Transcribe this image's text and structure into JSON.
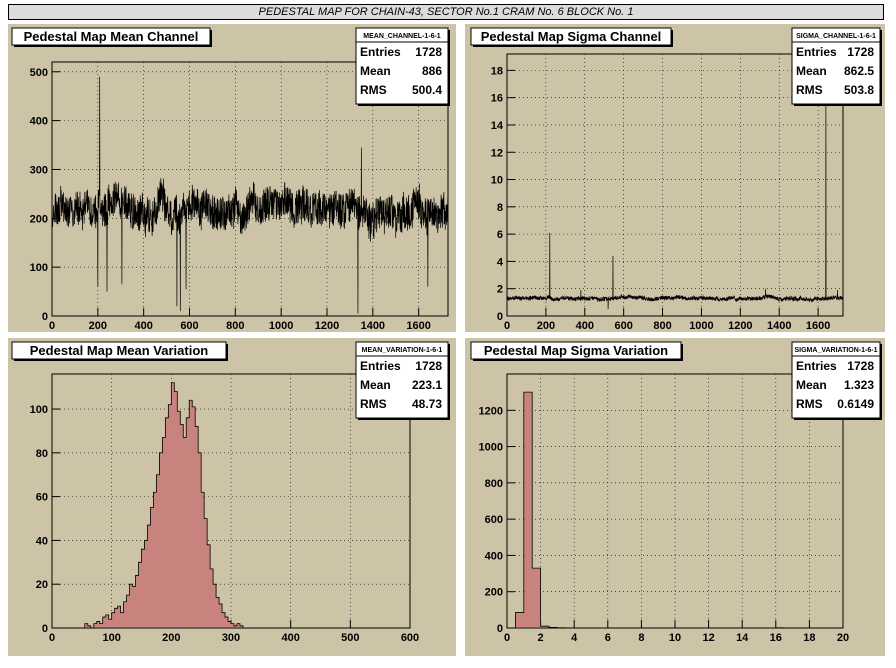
{
  "page_title": "PEDESTAL MAP FOR CHAIN-43, SECTOR No.1 CRAM No. 6 BLOCK No. 1",
  "colors": {
    "pad_bg": "#cdc4a8",
    "fill": "#c8837e",
    "line": "#000000"
  },
  "chart_data": [
    {
      "id": "mean-channel",
      "type": "line",
      "title": "Pedestal Map Mean Channel",
      "stats_name": "MEAN_CHANNEL-1-6-1",
      "stats": [
        {
          "label": "Entries",
          "value": "1728"
        },
        {
          "label": "Mean",
          "value": "886"
        },
        {
          "label": "RMS",
          "value": "500.4"
        }
      ],
      "xlim": [
        0,
        1728
      ],
      "ylim": [
        0,
        520
      ],
      "xticks": [
        0,
        200,
        400,
        600,
        800,
        1000,
        1200,
        1400,
        1600
      ],
      "yticks": [
        0,
        100,
        200,
        300,
        400,
        500
      ],
      "baseline": 220,
      "noise": 45,
      "n_points": 1728,
      "spikes": [
        {
          "x": 200,
          "y": 60
        },
        {
          "x": 208,
          "y": 490
        },
        {
          "x": 240,
          "y": 50
        },
        {
          "x": 305,
          "y": 65
        },
        {
          "x": 545,
          "y": 20
        },
        {
          "x": 560,
          "y": 10
        },
        {
          "x": 585,
          "y": 55
        },
        {
          "x": 1335,
          "y": 5
        },
        {
          "x": 1350,
          "y": 345
        },
        {
          "x": 1640,
          "y": 60
        }
      ]
    },
    {
      "id": "sigma-channel",
      "type": "line",
      "title": "Pedestal Map Sigma Channel",
      "stats_name": "SIGMA_CHANNEL-1-6-1",
      "stats": [
        {
          "label": "Entries",
          "value": "1728"
        },
        {
          "label": "Mean",
          "value": "862.5"
        },
        {
          "label": "RMS",
          "value": "503.8"
        }
      ],
      "xlim": [
        0,
        1728
      ],
      "ylim": [
        0,
        19.2
      ],
      "xticks": [
        0,
        200,
        400,
        600,
        800,
        1000,
        1200,
        1400,
        1600
      ],
      "yticks": [
        0,
        2,
        4,
        6,
        8,
        10,
        12,
        14,
        16,
        18
      ],
      "baseline": 1.3,
      "noise": 0.18,
      "n_points": 1728,
      "spikes": [
        {
          "x": 220,
          "y": 6.1
        },
        {
          "x": 380,
          "y": 1.9
        },
        {
          "x": 520,
          "y": 0.5
        },
        {
          "x": 545,
          "y": 4.4
        },
        {
          "x": 1330,
          "y": 2.0
        },
        {
          "x": 1640,
          "y": 16.0
        },
        {
          "x": 1700,
          "y": 1.9
        }
      ]
    },
    {
      "id": "mean-variation",
      "type": "bar",
      "title": "Pedestal Map Mean Variation",
      "stats_name": "MEAN_VARIATION-1-6-1",
      "stats": [
        {
          "label": "Entries",
          "value": "1728"
        },
        {
          "label": "Mean",
          "value": "223.1"
        },
        {
          "label": "RMS",
          "value": "48.73"
        }
      ],
      "xlim": [
        0,
        600
      ],
      "ylim": [
        0,
        116
      ],
      "xticks": [
        0,
        100,
        200,
        300,
        400,
        500,
        600
      ],
      "yticks": [
        0,
        20,
        40,
        60,
        80,
        100
      ],
      "bin_start": 0,
      "bin_width": 5,
      "values": [
        0,
        0,
        0,
        0,
        0,
        0,
        0,
        0,
        0,
        0,
        0,
        2,
        1,
        0,
        2,
        3,
        2,
        5,
        6,
        4,
        7,
        9,
        10,
        7,
        12,
        15,
        20,
        19,
        24,
        30,
        36,
        40,
        47,
        55,
        62,
        70,
        80,
        87,
        96,
        102,
        112,
        108,
        99,
        93,
        87,
        96,
        104,
        101,
        92,
        80,
        62,
        50,
        38,
        27,
        20,
        14,
        11,
        7,
        5,
        3,
        2,
        1,
        2,
        1,
        0,
        0,
        0,
        0,
        0,
        0,
        0,
        0,
        0,
        0,
        0,
        0,
        0,
        0,
        0,
        0,
        0,
        0,
        0,
        0,
        0,
        0,
        0,
        0,
        0,
        0,
        0,
        0,
        0,
        0,
        0,
        0,
        0,
        0,
        0,
        0,
        0,
        0,
        0,
        0,
        0,
        0,
        0,
        0,
        0,
        0,
        0,
        0,
        0,
        0,
        0,
        0,
        0,
        0,
        0,
        0
      ]
    },
    {
      "id": "sigma-variation",
      "type": "bar",
      "title": "Pedestal Map Sigma Variation",
      "stats_name": "SIGMA_VARIATION-1-6-1",
      "stats": [
        {
          "label": "Entries",
          "value": "1728"
        },
        {
          "label": "Mean",
          "value": "1.323"
        },
        {
          "label": "RMS",
          "value": "0.6149"
        }
      ],
      "xlim": [
        0,
        20
      ],
      "ylim": [
        0,
        1400
      ],
      "xticks": [
        0,
        2,
        4,
        6,
        8,
        10,
        12,
        14,
        16,
        18,
        20
      ],
      "yticks": [
        0,
        200,
        400,
        600,
        800,
        1000,
        1200
      ],
      "bin_start": 0,
      "bin_width": 0.5,
      "values": [
        0,
        85,
        1300,
        330,
        10,
        3,
        1,
        0,
        0,
        0,
        0,
        0,
        0,
        0,
        0,
        0,
        0,
        0,
        0,
        0,
        0,
        0,
        0,
        0,
        0,
        0,
        0,
        0,
        0,
        0,
        0,
        0,
        1,
        0,
        0,
        0,
        0,
        0,
        0,
        0
      ]
    }
  ]
}
